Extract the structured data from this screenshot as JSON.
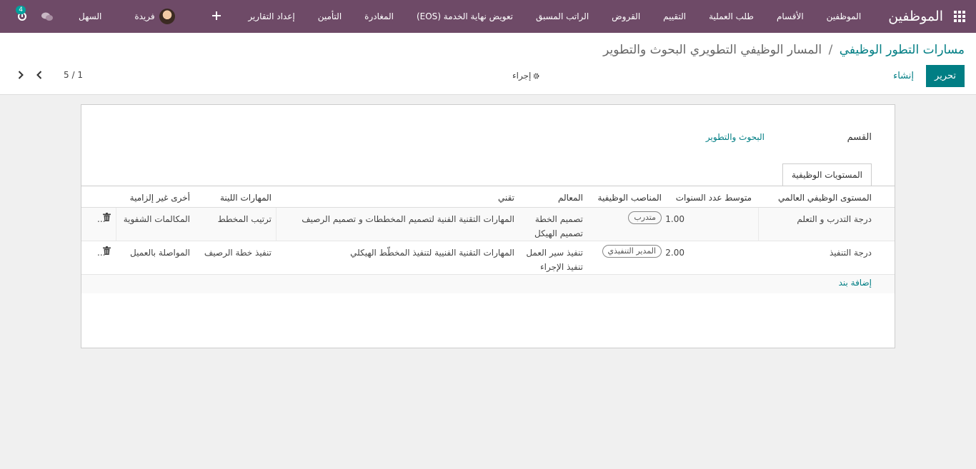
{
  "navbar": {
    "brand": "الموظفين",
    "menu": [
      "الموظفين",
      "الأقسام",
      "طلب العملية",
      "التقييم",
      "القروض",
      "الراتب المسبق",
      "تعويض نهاية الخدمة (EOS)",
      "المغادرة",
      "التأمين",
      "إعداد التقارير"
    ],
    "company": "السهل",
    "activity_count": "4",
    "user": "فريدة"
  },
  "control": {
    "breadcrumb_parent": "مسارات التطور الوظيفي",
    "breadcrumb_separator": "/",
    "breadcrumb_current": "المسار الوظيفي التطويري البحوث والتطوير",
    "edit_label": "تحرير",
    "create_label": "إنشاء",
    "action_label": "إجراء",
    "pager": "1 / 5"
  },
  "form": {
    "department_label": "القسم",
    "department_value": "البحوث والتطوير",
    "tab_label": "المستويات الوظيفية",
    "columns": {
      "level": "المستوى الوظيفي العالمي",
      "years": "متوسط عدد السنوات",
      "positions": "المناصب الوظيفية",
      "features": "المعالم",
      "technical": "تقني",
      "soft": "المهارات اللينة",
      "other": "أخرى غير إلزامية"
    },
    "rows": [
      {
        "level": "درجة التدرب و التعلم",
        "years": "1.00",
        "position_tag": "متدرب",
        "features_1": "تصميم الخطة",
        "features_2": "تصميم الهيكل",
        "technical": "المهارات التقنية الفنية لتصميم المخططات و تصميم الرصيف",
        "soft": "ترتيب المخطط",
        "other": "المكالمات الشفوية",
        "more": "..."
      },
      {
        "level": "درجة التنفيذ",
        "years": "2.00",
        "position_tag": "المدير التنفيذي",
        "features_1": "تنفيذ سير العمل",
        "features_2": "تنفيذ الإجراء",
        "technical": "المهارات التقنية الفنيية لتنفيذ المخطّط الهيكلي",
        "soft": "تنفيذ خطة الرصيف",
        "other": "المواصلة بالعميل",
        "more": "..."
      }
    ],
    "add_line": "إضافة بند"
  },
  "colors": {
    "navbar": "#6e4a67",
    "primary": "#017e84",
    "badge": "#00a09d"
  }
}
